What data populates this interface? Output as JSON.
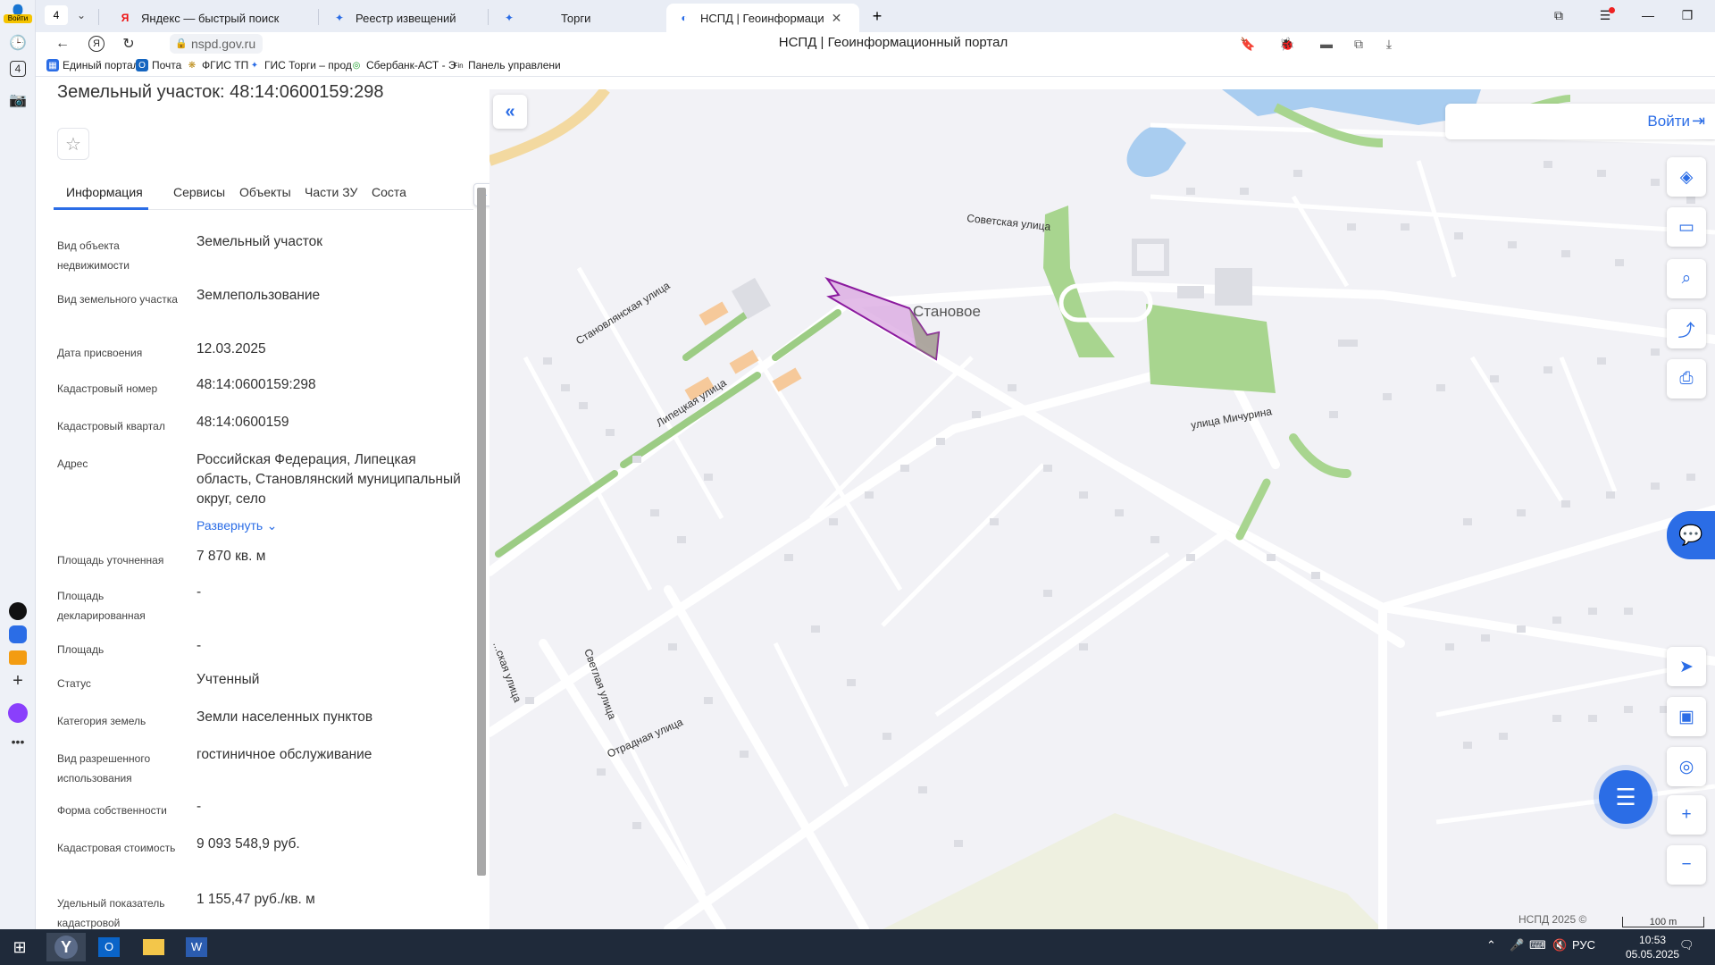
{
  "browser": {
    "tab_count": "4",
    "tabs": [
      {
        "title": "Яндекс — быстрый поиск",
        "icon": "yandex-icon"
      },
      {
        "title": "Реестр извещений",
        "icon": "emblem-icon"
      },
      {
        "title": "Торги",
        "icon": "emblem-icon"
      },
      {
        "title": "НСПД | Геоинформаци",
        "icon": "nspd-icon",
        "active": true
      }
    ],
    "url": "nspd.gov.ru",
    "page_title": "НСПД | Геоинформационный портал",
    "bookmarks": [
      {
        "label": "Единый портал"
      },
      {
        "label": "Почта"
      },
      {
        "label": "ФГИС ТП"
      },
      {
        "label": "ГИС Торги – прод"
      },
      {
        "label": "Сбербанк-АСТ - Э"
      },
      {
        "label": "Панель управлени"
      }
    ],
    "login_label": "Войти"
  },
  "panel": {
    "title": "Земельный участок: 48:14:0600159:298",
    "tabs": [
      "Информация",
      "Сервисы",
      "Объекты",
      "Части ЗУ",
      "Соста"
    ],
    "fields": [
      {
        "label": "Вид объекта недвижимости",
        "value": "Земельный участок"
      },
      {
        "label": "Вид земельного участка",
        "value": "Землепользование"
      },
      {
        "label": "Дата присвоения",
        "value": "12.03.2025"
      },
      {
        "label": "Кадастровый номер",
        "value": "48:14:0600159:298"
      },
      {
        "label": "Кадастровый квартал",
        "value": "48:14:0600159"
      },
      {
        "label": "Адрес",
        "value": "Российская Федерация, Липецкая область, Становлянский муниципальный округ, село"
      },
      {
        "label": "Площадь уточненная",
        "value": "7 870 кв. м"
      },
      {
        "label": "Площадь декларированная",
        "value": "-"
      },
      {
        "label": "Площадь",
        "value": "-"
      },
      {
        "label": "Статус",
        "value": "Учтенный"
      },
      {
        "label": "Категория земель",
        "value": "Земли населенных пунктов"
      },
      {
        "label": "Вид разрешенного использования",
        "value": "гостиничное обслуживание"
      },
      {
        "label": "Форма собственности",
        "value": "-"
      },
      {
        "label": "Кадастровая стоимость",
        "value": "9 093 548,9 руб."
      },
      {
        "label": "Удельный показатель кадастровой",
        "value": "1 155,47 руб./кв. м"
      }
    ],
    "expand_label": "Развернуть"
  },
  "map": {
    "login_label": "Войти",
    "labels": {
      "settlement": "Становое",
      "street_sovetskaya": "Советская улица",
      "street_stanovlyanskaya": "Становлянская улица",
      "street_lipetskaya": "Липецкая улица",
      "street_michurina": "улица Мичурина",
      "street_svetlaya": "Светлая улица",
      "street_otradnaya": "Отрадная улица",
      "street_left": "...ская улица"
    },
    "attribution": "НСПД 2025 ©",
    "scale_label": "100 m"
  },
  "taskbar": {
    "lang": "РУС",
    "time": "10:53",
    "date": "05.05.2025"
  },
  "rail": {
    "login_label": "Войти",
    "badge": "4"
  }
}
